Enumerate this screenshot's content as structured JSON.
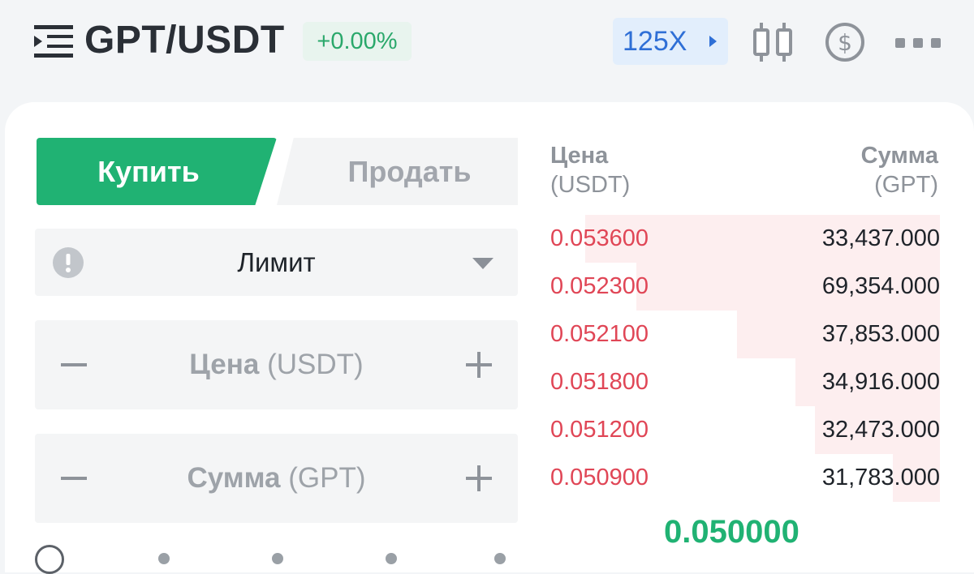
{
  "header": {
    "pair": "GPT/USDT",
    "change": "+0.00%",
    "leverage": "125X",
    "icons": [
      "menu-icon",
      "candlestick-chart-icon",
      "dollar-icon",
      "more-icon"
    ]
  },
  "trade_tabs": {
    "buy_label": "Купить",
    "sell_label": "Продать",
    "active": "buy"
  },
  "order_type": {
    "selected": "Лимит"
  },
  "price_input": {
    "label": "Цена",
    "unit": "(USDT)"
  },
  "amount_input": {
    "label": "Сумма",
    "unit": "(GPT)"
  },
  "order_book": {
    "price_header": "Цена",
    "price_unit": "(USDT)",
    "amount_header": "Сумма",
    "amount_unit": "(GPT)",
    "asks": [
      {
        "price": "0.053600",
        "amount": "33,437.000",
        "depth": 0.91
      },
      {
        "price": "0.052300",
        "amount": "69,354.000",
        "depth": 0.78
      },
      {
        "price": "0.052100",
        "amount": "37,853.000",
        "depth": 0.52
      },
      {
        "price": "0.051800",
        "amount": "34,916.000",
        "depth": 0.37
      },
      {
        "price": "0.051200",
        "amount": "32,473.000",
        "depth": 0.32
      },
      {
        "price": "0.050900",
        "amount": "31,783.000",
        "depth": 0.12
      }
    ],
    "last_price": "0.050000"
  },
  "colors": {
    "buy_green": "#20b273",
    "ask_red": "#e04656",
    "leverage_blue": "#2f6fd6"
  }
}
